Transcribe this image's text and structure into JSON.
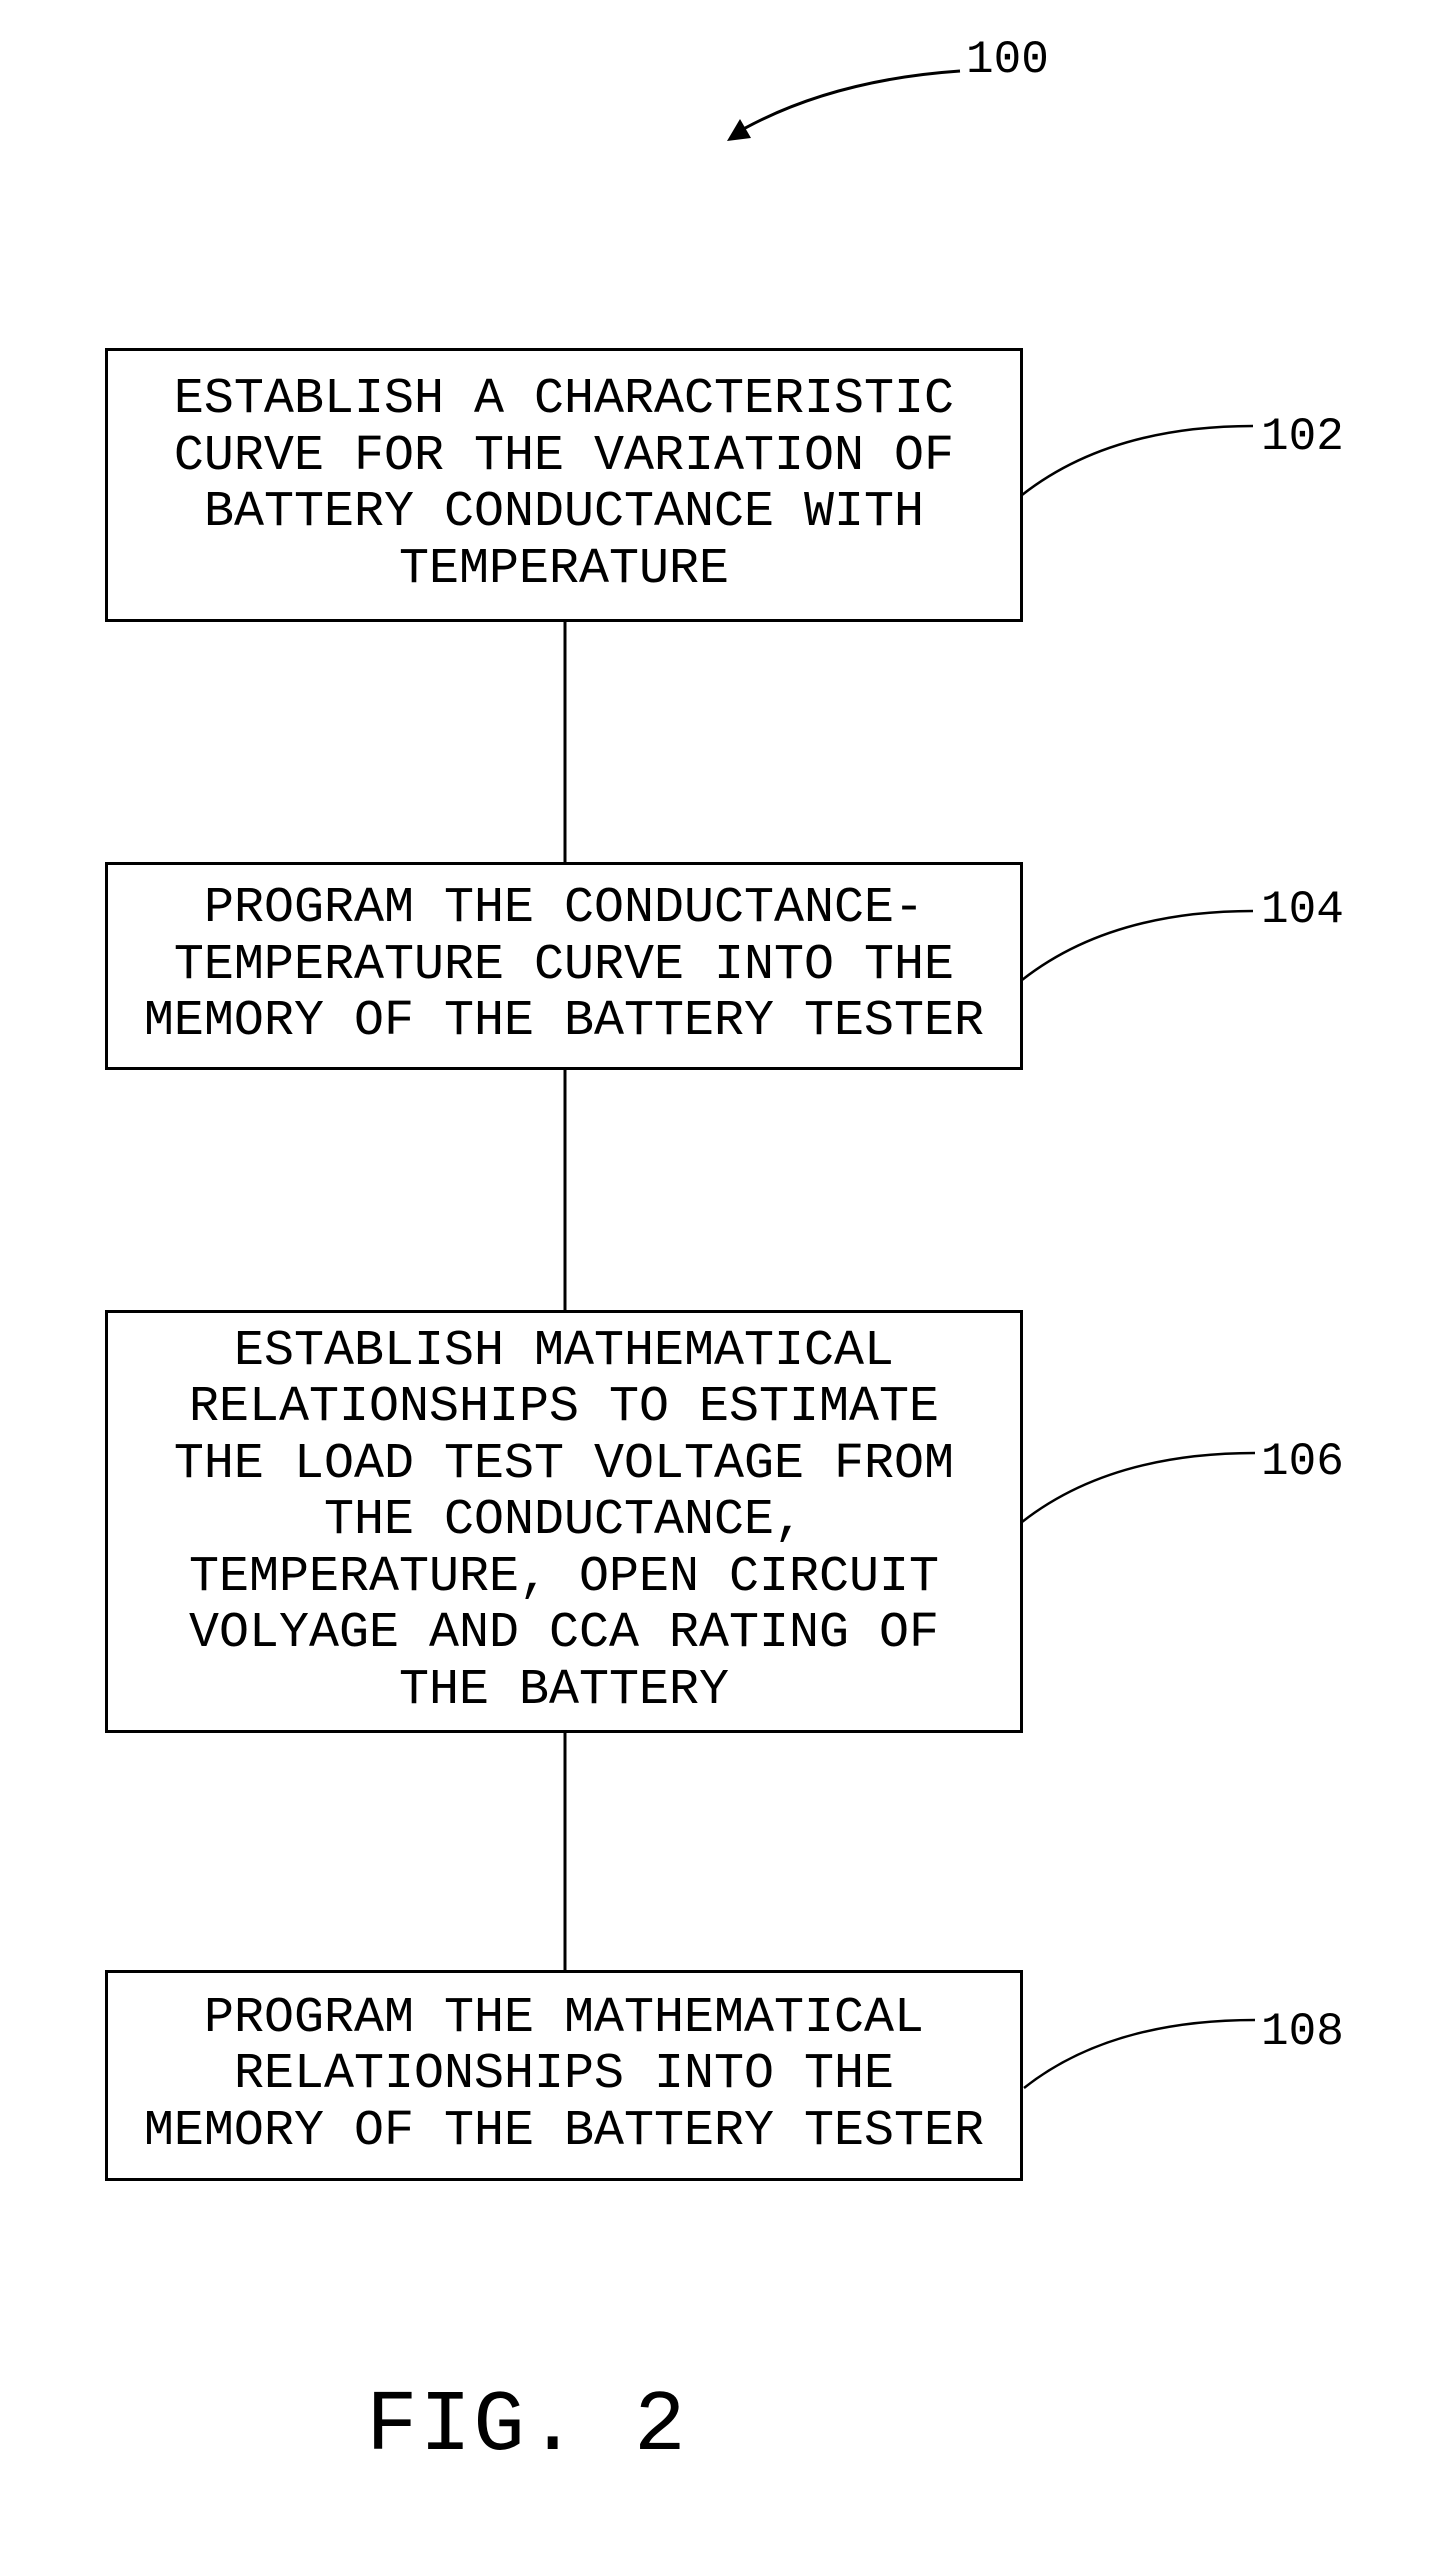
{
  "figure": {
    "title": "FIG. 2",
    "reference": "100"
  },
  "steps": [
    {
      "ref": "102",
      "lines": [
        "ESTABLISH A CHARACTERISTIC",
        "CURVE FOR THE VARIATION OF",
        "BATTERY CONDUCTANCE WITH",
        "TEMPERATURE"
      ]
    },
    {
      "ref": "104",
      "lines": [
        "PROGRAM THE CONDUCTANCE-",
        "TEMPERATURE CURVE INTO THE",
        "MEMORY OF THE BATTERY TESTER"
      ]
    },
    {
      "ref": "106",
      "lines": [
        "ESTABLISH MATHEMATICAL",
        "RELATIONSHIPS TO ESTIMATE",
        "THE LOAD TEST VOLTAGE FROM",
        "THE CONDUCTANCE,",
        "TEMPERATURE, OPEN CIRCUIT",
        "VOLYAGE AND CCA RATING OF",
        "THE BATTERY"
      ]
    },
    {
      "ref": "108",
      "lines": [
        "PROGRAM THE MATHEMATICAL",
        "RELATIONSHIPS INTO THE",
        "MEMORY OF THE BATTERY TESTER"
      ]
    }
  ]
}
